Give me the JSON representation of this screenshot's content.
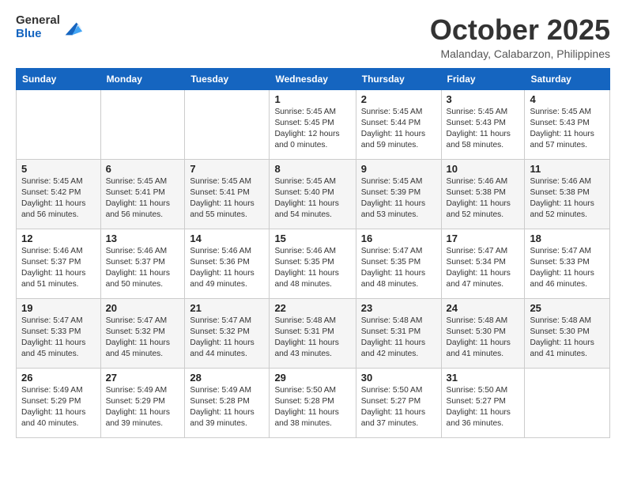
{
  "logo": {
    "general": "General",
    "blue": "Blue"
  },
  "header": {
    "month": "October 2025",
    "location": "Malanday, Calabarzon, Philippines"
  },
  "weekdays": [
    "Sunday",
    "Monday",
    "Tuesday",
    "Wednesday",
    "Thursday",
    "Friday",
    "Saturday"
  ],
  "weeks": [
    [
      {
        "day": "",
        "sunrise": "",
        "sunset": "",
        "daylight": ""
      },
      {
        "day": "",
        "sunrise": "",
        "sunset": "",
        "daylight": ""
      },
      {
        "day": "",
        "sunrise": "",
        "sunset": "",
        "daylight": ""
      },
      {
        "day": "1",
        "sunrise": "Sunrise: 5:45 AM",
        "sunset": "Sunset: 5:45 PM",
        "daylight": "Daylight: 12 hours and 0 minutes."
      },
      {
        "day": "2",
        "sunrise": "Sunrise: 5:45 AM",
        "sunset": "Sunset: 5:44 PM",
        "daylight": "Daylight: 11 hours and 59 minutes."
      },
      {
        "day": "3",
        "sunrise": "Sunrise: 5:45 AM",
        "sunset": "Sunset: 5:43 PM",
        "daylight": "Daylight: 11 hours and 58 minutes."
      },
      {
        "day": "4",
        "sunrise": "Sunrise: 5:45 AM",
        "sunset": "Sunset: 5:43 PM",
        "daylight": "Daylight: 11 hours and 57 minutes."
      }
    ],
    [
      {
        "day": "5",
        "sunrise": "Sunrise: 5:45 AM",
        "sunset": "Sunset: 5:42 PM",
        "daylight": "Daylight: 11 hours and 56 minutes."
      },
      {
        "day": "6",
        "sunrise": "Sunrise: 5:45 AM",
        "sunset": "Sunset: 5:41 PM",
        "daylight": "Daylight: 11 hours and 56 minutes."
      },
      {
        "day": "7",
        "sunrise": "Sunrise: 5:45 AM",
        "sunset": "Sunset: 5:41 PM",
        "daylight": "Daylight: 11 hours and 55 minutes."
      },
      {
        "day": "8",
        "sunrise": "Sunrise: 5:45 AM",
        "sunset": "Sunset: 5:40 PM",
        "daylight": "Daylight: 11 hours and 54 minutes."
      },
      {
        "day": "9",
        "sunrise": "Sunrise: 5:45 AM",
        "sunset": "Sunset: 5:39 PM",
        "daylight": "Daylight: 11 hours and 53 minutes."
      },
      {
        "day": "10",
        "sunrise": "Sunrise: 5:46 AM",
        "sunset": "Sunset: 5:38 PM",
        "daylight": "Daylight: 11 hours and 52 minutes."
      },
      {
        "day": "11",
        "sunrise": "Sunrise: 5:46 AM",
        "sunset": "Sunset: 5:38 PM",
        "daylight": "Daylight: 11 hours and 52 minutes."
      }
    ],
    [
      {
        "day": "12",
        "sunrise": "Sunrise: 5:46 AM",
        "sunset": "Sunset: 5:37 PM",
        "daylight": "Daylight: 11 hours and 51 minutes."
      },
      {
        "day": "13",
        "sunrise": "Sunrise: 5:46 AM",
        "sunset": "Sunset: 5:37 PM",
        "daylight": "Daylight: 11 hours and 50 minutes."
      },
      {
        "day": "14",
        "sunrise": "Sunrise: 5:46 AM",
        "sunset": "Sunset: 5:36 PM",
        "daylight": "Daylight: 11 hours and 49 minutes."
      },
      {
        "day": "15",
        "sunrise": "Sunrise: 5:46 AM",
        "sunset": "Sunset: 5:35 PM",
        "daylight": "Daylight: 11 hours and 48 minutes."
      },
      {
        "day": "16",
        "sunrise": "Sunrise: 5:47 AM",
        "sunset": "Sunset: 5:35 PM",
        "daylight": "Daylight: 11 hours and 48 minutes."
      },
      {
        "day": "17",
        "sunrise": "Sunrise: 5:47 AM",
        "sunset": "Sunset: 5:34 PM",
        "daylight": "Daylight: 11 hours and 47 minutes."
      },
      {
        "day": "18",
        "sunrise": "Sunrise: 5:47 AM",
        "sunset": "Sunset: 5:33 PM",
        "daylight": "Daylight: 11 hours and 46 minutes."
      }
    ],
    [
      {
        "day": "19",
        "sunrise": "Sunrise: 5:47 AM",
        "sunset": "Sunset: 5:33 PM",
        "daylight": "Daylight: 11 hours and 45 minutes."
      },
      {
        "day": "20",
        "sunrise": "Sunrise: 5:47 AM",
        "sunset": "Sunset: 5:32 PM",
        "daylight": "Daylight: 11 hours and 45 minutes."
      },
      {
        "day": "21",
        "sunrise": "Sunrise: 5:47 AM",
        "sunset": "Sunset: 5:32 PM",
        "daylight": "Daylight: 11 hours and 44 minutes."
      },
      {
        "day": "22",
        "sunrise": "Sunrise: 5:48 AM",
        "sunset": "Sunset: 5:31 PM",
        "daylight": "Daylight: 11 hours and 43 minutes."
      },
      {
        "day": "23",
        "sunrise": "Sunrise: 5:48 AM",
        "sunset": "Sunset: 5:31 PM",
        "daylight": "Daylight: 11 hours and 42 minutes."
      },
      {
        "day": "24",
        "sunrise": "Sunrise: 5:48 AM",
        "sunset": "Sunset: 5:30 PM",
        "daylight": "Daylight: 11 hours and 41 minutes."
      },
      {
        "day": "25",
        "sunrise": "Sunrise: 5:48 AM",
        "sunset": "Sunset: 5:30 PM",
        "daylight": "Daylight: 11 hours and 41 minutes."
      }
    ],
    [
      {
        "day": "26",
        "sunrise": "Sunrise: 5:49 AM",
        "sunset": "Sunset: 5:29 PM",
        "daylight": "Daylight: 11 hours and 40 minutes."
      },
      {
        "day": "27",
        "sunrise": "Sunrise: 5:49 AM",
        "sunset": "Sunset: 5:29 PM",
        "daylight": "Daylight: 11 hours and 39 minutes."
      },
      {
        "day": "28",
        "sunrise": "Sunrise: 5:49 AM",
        "sunset": "Sunset: 5:28 PM",
        "daylight": "Daylight: 11 hours and 39 minutes."
      },
      {
        "day": "29",
        "sunrise": "Sunrise: 5:50 AM",
        "sunset": "Sunset: 5:28 PM",
        "daylight": "Daylight: 11 hours and 38 minutes."
      },
      {
        "day": "30",
        "sunrise": "Sunrise: 5:50 AM",
        "sunset": "Sunset: 5:27 PM",
        "daylight": "Daylight: 11 hours and 37 minutes."
      },
      {
        "day": "31",
        "sunrise": "Sunrise: 5:50 AM",
        "sunset": "Sunset: 5:27 PM",
        "daylight": "Daylight: 11 hours and 36 minutes."
      },
      {
        "day": "",
        "sunrise": "",
        "sunset": "",
        "daylight": ""
      }
    ]
  ]
}
